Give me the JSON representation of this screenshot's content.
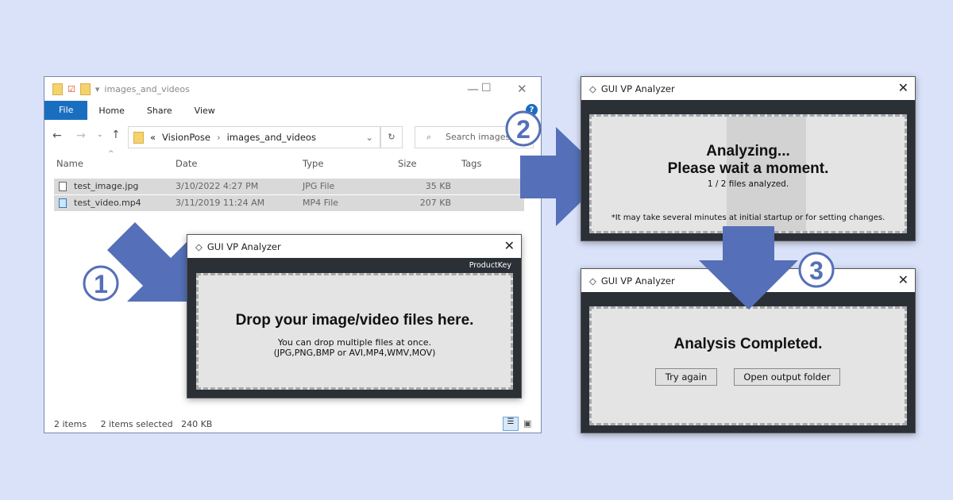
{
  "explorer": {
    "title": "images_and_videos",
    "ribbon": [
      "File",
      "Home",
      "Share",
      "View"
    ],
    "address": {
      "parent_marker": "«",
      "crumbs": [
        "VisionPose",
        "images_and_videos"
      ]
    },
    "search_placeholder": "Search images_and_videos",
    "columns": [
      "Name",
      "Date",
      "Type",
      "Size",
      "Tags"
    ],
    "files": [
      {
        "name": "test_image.jpg",
        "date": "3/10/2022 4:27 PM",
        "type": "JPG File",
        "size": "35 KB"
      },
      {
        "name": "test_video.mp4",
        "date": "3/11/2019 11:24 AM",
        "type": "MP4 File",
        "size": "207 KB"
      }
    ],
    "status": {
      "count": "2 items",
      "selected": "2 items selected",
      "size": "240 KB"
    }
  },
  "app_title": "GUI VP Analyzer",
  "dialog1": {
    "product_key": "ProductKey",
    "heading": "Drop your image/video files here.",
    "line1": "You can drop multiple files at once.",
    "line2": "(JPG,PNG,BMP or AVI,MP4,WMV,MOV)"
  },
  "dialog2": {
    "line1": "Analyzing...",
    "line2": "Please wait a moment.",
    "progress": "1 / 2 files analyzed.",
    "note": "*It may take several minutes at initial startup or for setting changes."
  },
  "dialog3": {
    "heading": "Analysis Completed.",
    "try_again": "Try again",
    "open_folder": "Open output folder"
  },
  "steps": [
    "1",
    "2",
    "3"
  ],
  "colors": {
    "background": "#dae2fa",
    "arrow": "#5570b8",
    "dialog_body": "#2b2f36",
    "accent": "#1a6ec0"
  }
}
